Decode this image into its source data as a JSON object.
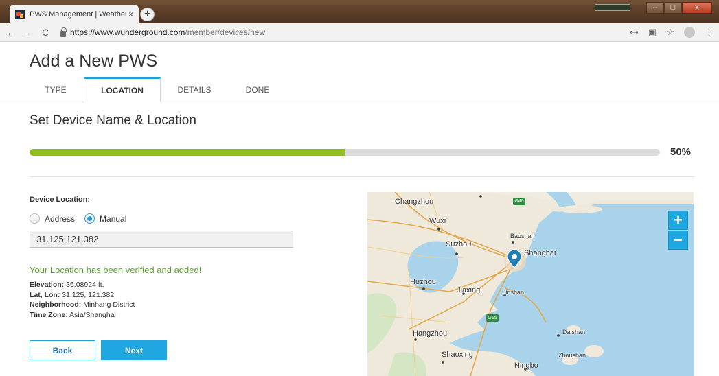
{
  "browser": {
    "tab_title": "PWS Management | Weather U",
    "tab_close": "×",
    "new_tab": "+",
    "url_host": "https://www.wunderground.com",
    "url_path": "/member/devices/new",
    "window_min": "–",
    "window_max": "□",
    "window_close": "x"
  },
  "page": {
    "title": "Add a New PWS",
    "tabs": [
      {
        "label": "TYPE"
      },
      {
        "label": "LOCATION"
      },
      {
        "label": "DETAILS"
      },
      {
        "label": "DONE"
      }
    ],
    "section_title": "Set Device Name & Location",
    "progress": {
      "percent": 50,
      "label": "50%"
    }
  },
  "form": {
    "device_location_label": "Device Location:",
    "radio_address": "Address",
    "radio_manual": "Manual",
    "selected": "Manual",
    "location_value": "31.125,121.382",
    "verified_message": "Your Location has been verified and added!",
    "elevation_label": "Elevation:",
    "elevation_value": "36.08924 ft.",
    "latlon_label": "Lat, Lon:",
    "latlon_value": "31.125, 121.382",
    "neighborhood_label": "Neighborhood:",
    "neighborhood_value": "Minhang District",
    "timezone_label": "Time Zone:",
    "timezone_value": "Asia/Shanghai",
    "back_button": "Back",
    "next_button": "Next"
  },
  "map": {
    "labels": [
      "Changzhou",
      "Wuxi",
      "Suzhou",
      "Baoshan",
      "Shanghai",
      "Huzhou",
      "Jiaxing",
      "Jinshan",
      "Hangzhou",
      "Daishan",
      "Shaoxing",
      "Zhoushan",
      "Ningbo"
    ],
    "highway_shields": [
      "G40",
      "G15"
    ],
    "zoom_in": "+",
    "zoom_out": "−"
  },
  "colors": {
    "accent": "#1ea7e0",
    "progress_fill": "#8fbf1f",
    "verified": "#5aa02c"
  }
}
